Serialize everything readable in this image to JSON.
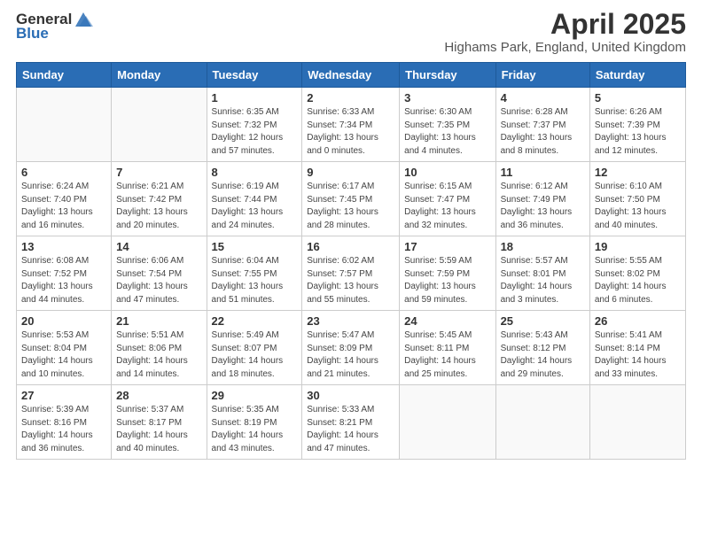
{
  "logo": {
    "general": "General",
    "blue": "Blue"
  },
  "title": {
    "month": "April 2025",
    "location": "Highams Park, England, United Kingdom"
  },
  "days_of_week": [
    "Sunday",
    "Monday",
    "Tuesday",
    "Wednesday",
    "Thursday",
    "Friday",
    "Saturday"
  ],
  "weeks": [
    [
      {
        "day": "",
        "info": ""
      },
      {
        "day": "",
        "info": ""
      },
      {
        "day": "1",
        "info": "Sunrise: 6:35 AM\nSunset: 7:32 PM\nDaylight: 12 hours and 57 minutes."
      },
      {
        "day": "2",
        "info": "Sunrise: 6:33 AM\nSunset: 7:34 PM\nDaylight: 13 hours and 0 minutes."
      },
      {
        "day": "3",
        "info": "Sunrise: 6:30 AM\nSunset: 7:35 PM\nDaylight: 13 hours and 4 minutes."
      },
      {
        "day": "4",
        "info": "Sunrise: 6:28 AM\nSunset: 7:37 PM\nDaylight: 13 hours and 8 minutes."
      },
      {
        "day": "5",
        "info": "Sunrise: 6:26 AM\nSunset: 7:39 PM\nDaylight: 13 hours and 12 minutes."
      }
    ],
    [
      {
        "day": "6",
        "info": "Sunrise: 6:24 AM\nSunset: 7:40 PM\nDaylight: 13 hours and 16 minutes."
      },
      {
        "day": "7",
        "info": "Sunrise: 6:21 AM\nSunset: 7:42 PM\nDaylight: 13 hours and 20 minutes."
      },
      {
        "day": "8",
        "info": "Sunrise: 6:19 AM\nSunset: 7:44 PM\nDaylight: 13 hours and 24 minutes."
      },
      {
        "day": "9",
        "info": "Sunrise: 6:17 AM\nSunset: 7:45 PM\nDaylight: 13 hours and 28 minutes."
      },
      {
        "day": "10",
        "info": "Sunrise: 6:15 AM\nSunset: 7:47 PM\nDaylight: 13 hours and 32 minutes."
      },
      {
        "day": "11",
        "info": "Sunrise: 6:12 AM\nSunset: 7:49 PM\nDaylight: 13 hours and 36 minutes."
      },
      {
        "day": "12",
        "info": "Sunrise: 6:10 AM\nSunset: 7:50 PM\nDaylight: 13 hours and 40 minutes."
      }
    ],
    [
      {
        "day": "13",
        "info": "Sunrise: 6:08 AM\nSunset: 7:52 PM\nDaylight: 13 hours and 44 minutes."
      },
      {
        "day": "14",
        "info": "Sunrise: 6:06 AM\nSunset: 7:54 PM\nDaylight: 13 hours and 47 minutes."
      },
      {
        "day": "15",
        "info": "Sunrise: 6:04 AM\nSunset: 7:55 PM\nDaylight: 13 hours and 51 minutes."
      },
      {
        "day": "16",
        "info": "Sunrise: 6:02 AM\nSunset: 7:57 PM\nDaylight: 13 hours and 55 minutes."
      },
      {
        "day": "17",
        "info": "Sunrise: 5:59 AM\nSunset: 7:59 PM\nDaylight: 13 hours and 59 minutes."
      },
      {
        "day": "18",
        "info": "Sunrise: 5:57 AM\nSunset: 8:01 PM\nDaylight: 14 hours and 3 minutes."
      },
      {
        "day": "19",
        "info": "Sunrise: 5:55 AM\nSunset: 8:02 PM\nDaylight: 14 hours and 6 minutes."
      }
    ],
    [
      {
        "day": "20",
        "info": "Sunrise: 5:53 AM\nSunset: 8:04 PM\nDaylight: 14 hours and 10 minutes."
      },
      {
        "day": "21",
        "info": "Sunrise: 5:51 AM\nSunset: 8:06 PM\nDaylight: 14 hours and 14 minutes."
      },
      {
        "day": "22",
        "info": "Sunrise: 5:49 AM\nSunset: 8:07 PM\nDaylight: 14 hours and 18 minutes."
      },
      {
        "day": "23",
        "info": "Sunrise: 5:47 AM\nSunset: 8:09 PM\nDaylight: 14 hours and 21 minutes."
      },
      {
        "day": "24",
        "info": "Sunrise: 5:45 AM\nSunset: 8:11 PM\nDaylight: 14 hours and 25 minutes."
      },
      {
        "day": "25",
        "info": "Sunrise: 5:43 AM\nSunset: 8:12 PM\nDaylight: 14 hours and 29 minutes."
      },
      {
        "day": "26",
        "info": "Sunrise: 5:41 AM\nSunset: 8:14 PM\nDaylight: 14 hours and 33 minutes."
      }
    ],
    [
      {
        "day": "27",
        "info": "Sunrise: 5:39 AM\nSunset: 8:16 PM\nDaylight: 14 hours and 36 minutes."
      },
      {
        "day": "28",
        "info": "Sunrise: 5:37 AM\nSunset: 8:17 PM\nDaylight: 14 hours and 40 minutes."
      },
      {
        "day": "29",
        "info": "Sunrise: 5:35 AM\nSunset: 8:19 PM\nDaylight: 14 hours and 43 minutes."
      },
      {
        "day": "30",
        "info": "Sunrise: 5:33 AM\nSunset: 8:21 PM\nDaylight: 14 hours and 47 minutes."
      },
      {
        "day": "",
        "info": ""
      },
      {
        "day": "",
        "info": ""
      },
      {
        "day": "",
        "info": ""
      }
    ]
  ]
}
